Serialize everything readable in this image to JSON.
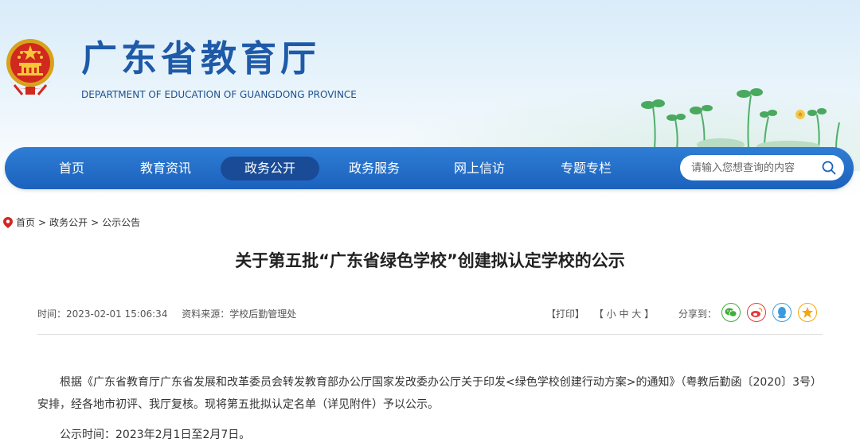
{
  "header": {
    "title_cn": "广东省教育厅",
    "title_en": "DEPARTMENT OF EDUCATION OF GUANGDONG PROVINCE"
  },
  "nav": {
    "items": [
      {
        "label": "首页"
      },
      {
        "label": "教育资讯"
      },
      {
        "label": "政务公开"
      },
      {
        "label": "政务服务"
      },
      {
        "label": "网上信访"
      },
      {
        "label": "专题专栏"
      }
    ],
    "active": "政务公开",
    "search_placeholder": "请输入您想查询的内容"
  },
  "breadcrumb": [
    "首页",
    "政务公开",
    "公示公告"
  ],
  "breadcrumb_sep": ">",
  "article": {
    "title": "关于第五批“广东省绿色学校”创建拟认定学校的公示",
    "time": "时间：2023-02-01 15:06:34",
    "source": "资料来源：学校后勤管理处",
    "print": "【打印】",
    "font_size": "【 小  中  大 】",
    "share_label": "分享到：",
    "paragraph1": "根据《广东省教育厅广东省发展和改革委员会转发教育部办公厅国家发改委办公厅关于印发<绿色学校创建行动方案>的通知》（粤教后勤函〔2020〕3号）安排，经各地市初评、我厅复核。现将第五批拟认定名单（详见附件）予以公示。",
    "paragraph2": "公示时间：2023年2月1日至2月7日。"
  },
  "colors": {
    "brand": "#1e5aa8",
    "nav": "#2670c9",
    "nav_active": "#1a4b96",
    "wechat": "#3fae3a",
    "weibo": "#e4393c",
    "qq": "#3b9be0",
    "qzone": "#f2a712"
  },
  "icons": [
    "national-emblem-icon",
    "search-icon",
    "location-pin-icon",
    "wechat-icon",
    "weibo-icon",
    "qq-icon",
    "qzone-icon"
  ]
}
